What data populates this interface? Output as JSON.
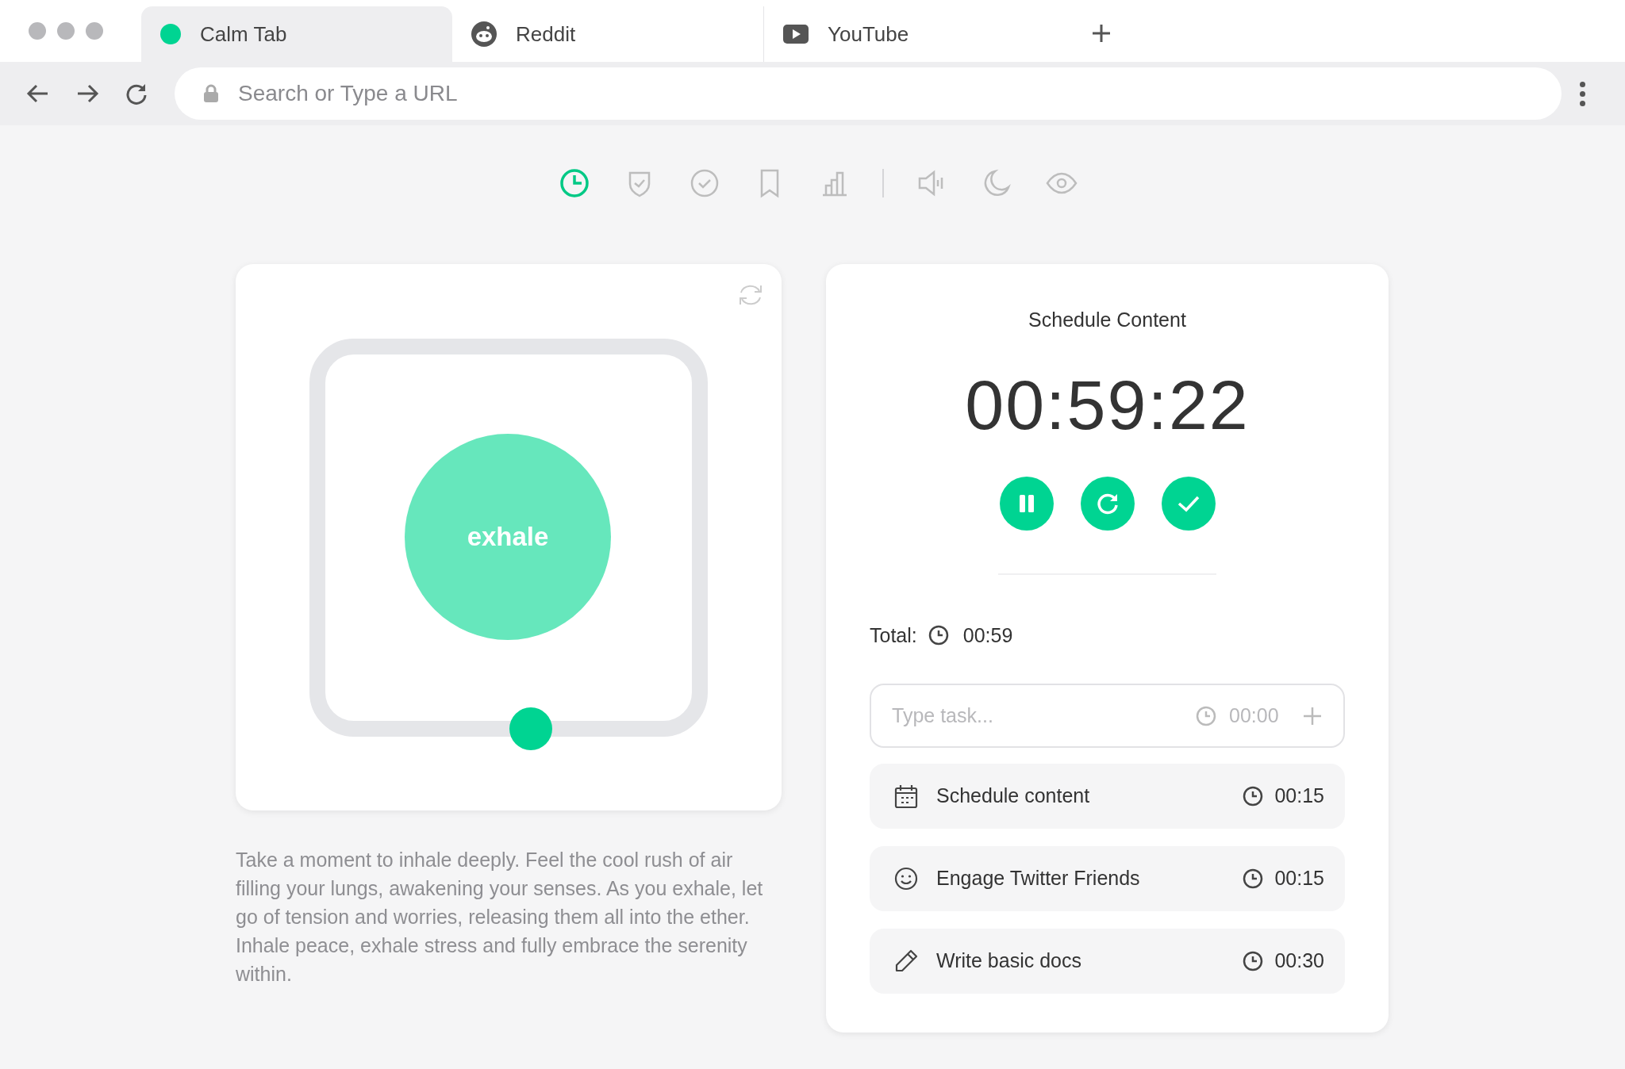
{
  "tabs": [
    {
      "title": "Calm Tab",
      "selected": true
    },
    {
      "title": "Reddit",
      "selected": false
    },
    {
      "title": "YouTube",
      "selected": false
    }
  ],
  "address_bar": {
    "placeholder": "Search or Type a URL"
  },
  "toolbar": [
    {
      "selected": true
    },
    {
      "selected": false
    },
    {
      "selected": false
    },
    {
      "selected": false
    },
    {
      "selected": false
    },
    {
      "selected": false
    },
    {
      "selected": false
    },
    {
      "selected": false
    }
  ],
  "breathing": {
    "phase": "exhale",
    "level": 0.56
  },
  "description": "Take a moment to inhale deeply. Feel the cool rush of air filling your lungs, awakening your senses. As you exhale, let go of tension and worries, releasing them all into the ether. Inhale peace, exhale stress and fully embrace the serenity within.",
  "timer": {
    "title": "Schedule Content",
    "time": "00:59:22"
  },
  "total": {
    "label": "Total:",
    "value": "00:59"
  },
  "new_task": {
    "placeholder": "Type task...",
    "duration_placeholder": "00:00"
  },
  "tasks": [
    {
      "name": "Schedule content",
      "duration": "00:15"
    },
    {
      "name": "Engage Twitter Friends",
      "duration": "00:15"
    },
    {
      "name": "Write basic docs",
      "duration": "00:30"
    }
  ]
}
